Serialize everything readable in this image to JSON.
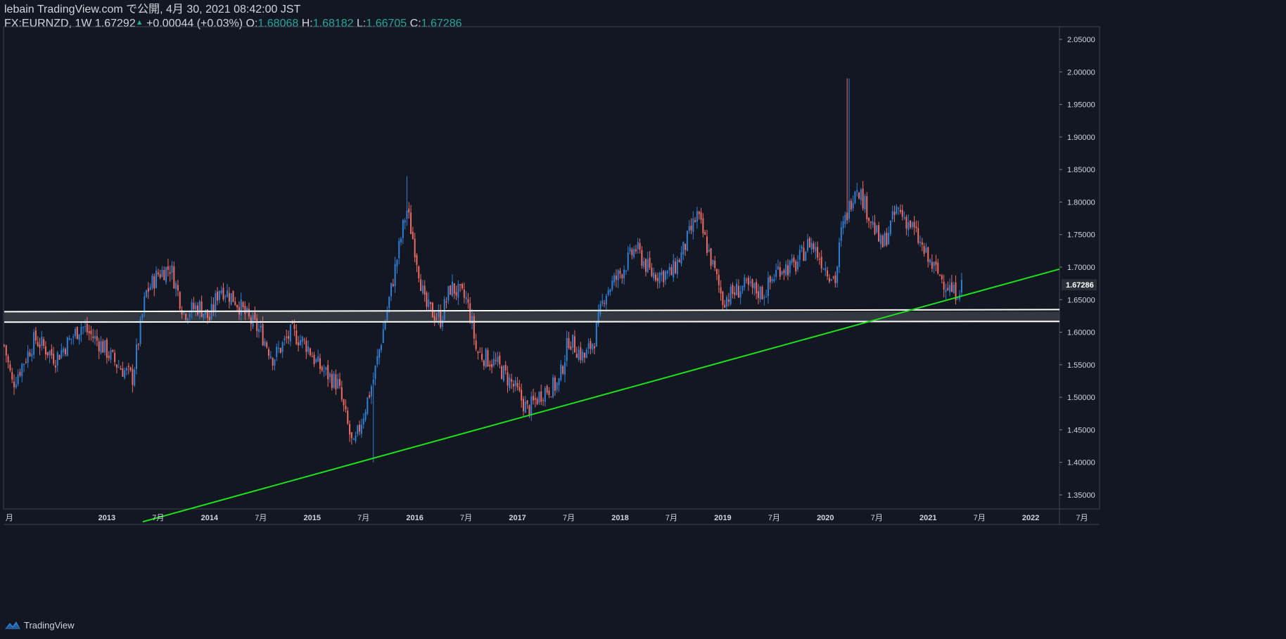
{
  "header": {
    "line1": "lebain TradingView.com で公開, 4月 30, 2021 08:42:00 JST",
    "symbol": "FX:EURNZD, 1W 1.67292",
    "change": "+0.00044 (+0.03%)",
    "o_label": "O:",
    "o_val": "1.68068",
    "h_label": "H:",
    "h_val": "1.68182",
    "l_label": "L:",
    "l_val": "1.66705",
    "c_label": "C:",
    "c_val": "1.67286"
  },
  "footer": {
    "brand": "TradingView"
  },
  "colors": {
    "background": "#131722",
    "up": "#2e7fd6",
    "down": "#ef6b63",
    "text": "#d1d4dc",
    "value": "#26a69a",
    "trendline": "#1ee01e",
    "zone_line": "#ffffff",
    "zone_fill": "#3a3d45"
  },
  "chart_data": {
    "type": "candlestick",
    "symbol": "FX:EURNZD",
    "interval": "1W",
    "ylim": [
      1.32,
      2.06
    ],
    "y_ticks": [
      "2.05000",
      "2.00000",
      "1.95000",
      "1.90000",
      "1.85000",
      "1.80000",
      "1.75000",
      "1.70000",
      "1.65000",
      "1.60000",
      "1.55000",
      "1.50000",
      "1.45000",
      "1.40000",
      "1.35000"
    ],
    "x_ticks": [
      {
        "label": "月",
        "x": 2012.05
      },
      {
        "label": "2013",
        "x": 2013.0
      },
      {
        "label": "7月",
        "x": 2013.5
      },
      {
        "label": "2014",
        "x": 2014.0
      },
      {
        "label": "7月",
        "x": 2014.5
      },
      {
        "label": "2015",
        "x": 2015.0
      },
      {
        "label": "7月",
        "x": 2015.5
      },
      {
        "label": "2016",
        "x": 2016.0
      },
      {
        "label": "7月",
        "x": 2016.5
      },
      {
        "label": "2017",
        "x": 2017.0
      },
      {
        "label": "7月",
        "x": 2017.5
      },
      {
        "label": "2018",
        "x": 2018.0
      },
      {
        "label": "7月",
        "x": 2018.5
      },
      {
        "label": "2019",
        "x": 2019.0
      },
      {
        "label": "7月",
        "x": 2019.5
      },
      {
        "label": "2020",
        "x": 2020.0
      },
      {
        "label": "7月",
        "x": 2020.5
      },
      {
        "label": "2021",
        "x": 2021.0
      },
      {
        "label": "7月",
        "x": 2021.5
      },
      {
        "label": "2022",
        "x": 2022.0
      },
      {
        "label": "7月",
        "x": 2022.5
      }
    ],
    "x_range": [
      2012.0,
      2022.28
    ],
    "last_price_label": "1.67286",
    "last_price": 1.67286,
    "price_path": [
      [
        2012.0,
        1.58
      ],
      [
        2012.08,
        1.52
      ],
      [
        2012.3,
        1.59
      ],
      [
        2012.5,
        1.56
      ],
      [
        2012.75,
        1.61
      ],
      [
        2012.95,
        1.58
      ],
      [
        2013.1,
        1.55
      ],
      [
        2013.25,
        1.53
      ],
      [
        2013.38,
        1.66
      ],
      [
        2013.5,
        1.69
      ],
      [
        2013.62,
        1.7
      ],
      [
        2013.75,
        1.63
      ],
      [
        2013.9,
        1.64
      ],
      [
        2014.0,
        1.62
      ],
      [
        2014.1,
        1.67
      ],
      [
        2014.25,
        1.65
      ],
      [
        2014.38,
        1.62
      ],
      [
        2014.5,
        1.6
      ],
      [
        2014.62,
        1.56
      ],
      [
        2014.8,
        1.6
      ],
      [
        2014.95,
        1.58
      ],
      [
        2015.05,
        1.55
      ],
      [
        2015.25,
        1.52
      ],
      [
        2015.4,
        1.42
      ],
      [
        2015.6,
        1.53
      ],
      [
        2015.75,
        1.65
      ],
      [
        2015.92,
        1.79
      ],
      [
        2016.0,
        1.73
      ],
      [
        2016.1,
        1.64
      ],
      [
        2016.25,
        1.62
      ],
      [
        2016.35,
        1.67
      ],
      [
        2016.5,
        1.65
      ],
      [
        2016.55,
        1.62
      ],
      [
        2016.6,
        1.57
      ],
      [
        2016.8,
        1.55
      ],
      [
        2016.95,
        1.52
      ],
      [
        2017.1,
        1.48
      ],
      [
        2017.25,
        1.51
      ],
      [
        2017.4,
        1.52
      ],
      [
        2017.5,
        1.59
      ],
      [
        2017.65,
        1.56
      ],
      [
        2017.75,
        1.59
      ],
      [
        2017.85,
        1.66
      ],
      [
        2018.0,
        1.69
      ],
      [
        2018.15,
        1.73
      ],
      [
        2018.3,
        1.69
      ],
      [
        2018.5,
        1.69
      ],
      [
        2018.6,
        1.72
      ],
      [
        2018.75,
        1.78
      ],
      [
        2018.85,
        1.73
      ],
      [
        2019.0,
        1.65
      ],
      [
        2019.2,
        1.67
      ],
      [
        2019.4,
        1.66
      ],
      [
        2019.55,
        1.7
      ],
      [
        2019.7,
        1.7
      ],
      [
        2019.85,
        1.74
      ],
      [
        2020.0,
        1.7
      ],
      [
        2020.1,
        1.68
      ],
      [
        2020.15,
        1.75
      ],
      [
        2020.3,
        1.83
      ],
      [
        2020.45,
        1.77
      ],
      [
        2020.55,
        1.73
      ],
      [
        2020.7,
        1.79
      ],
      [
        2020.85,
        1.76
      ],
      [
        2021.0,
        1.71
      ],
      [
        2021.15,
        1.68
      ],
      [
        2021.25,
        1.66
      ],
      [
        2021.33,
        1.672
      ]
    ],
    "annotations": [
      {
        "type": "horizontal_line",
        "y": 1.6315
      },
      {
        "type": "horizontal_line",
        "y": 1.6155
      },
      {
        "type": "trend_line",
        "p1": [
          2012.0,
          1.25
        ],
        "p2": [
          2022.28,
          1.697
        ]
      }
    ]
  }
}
